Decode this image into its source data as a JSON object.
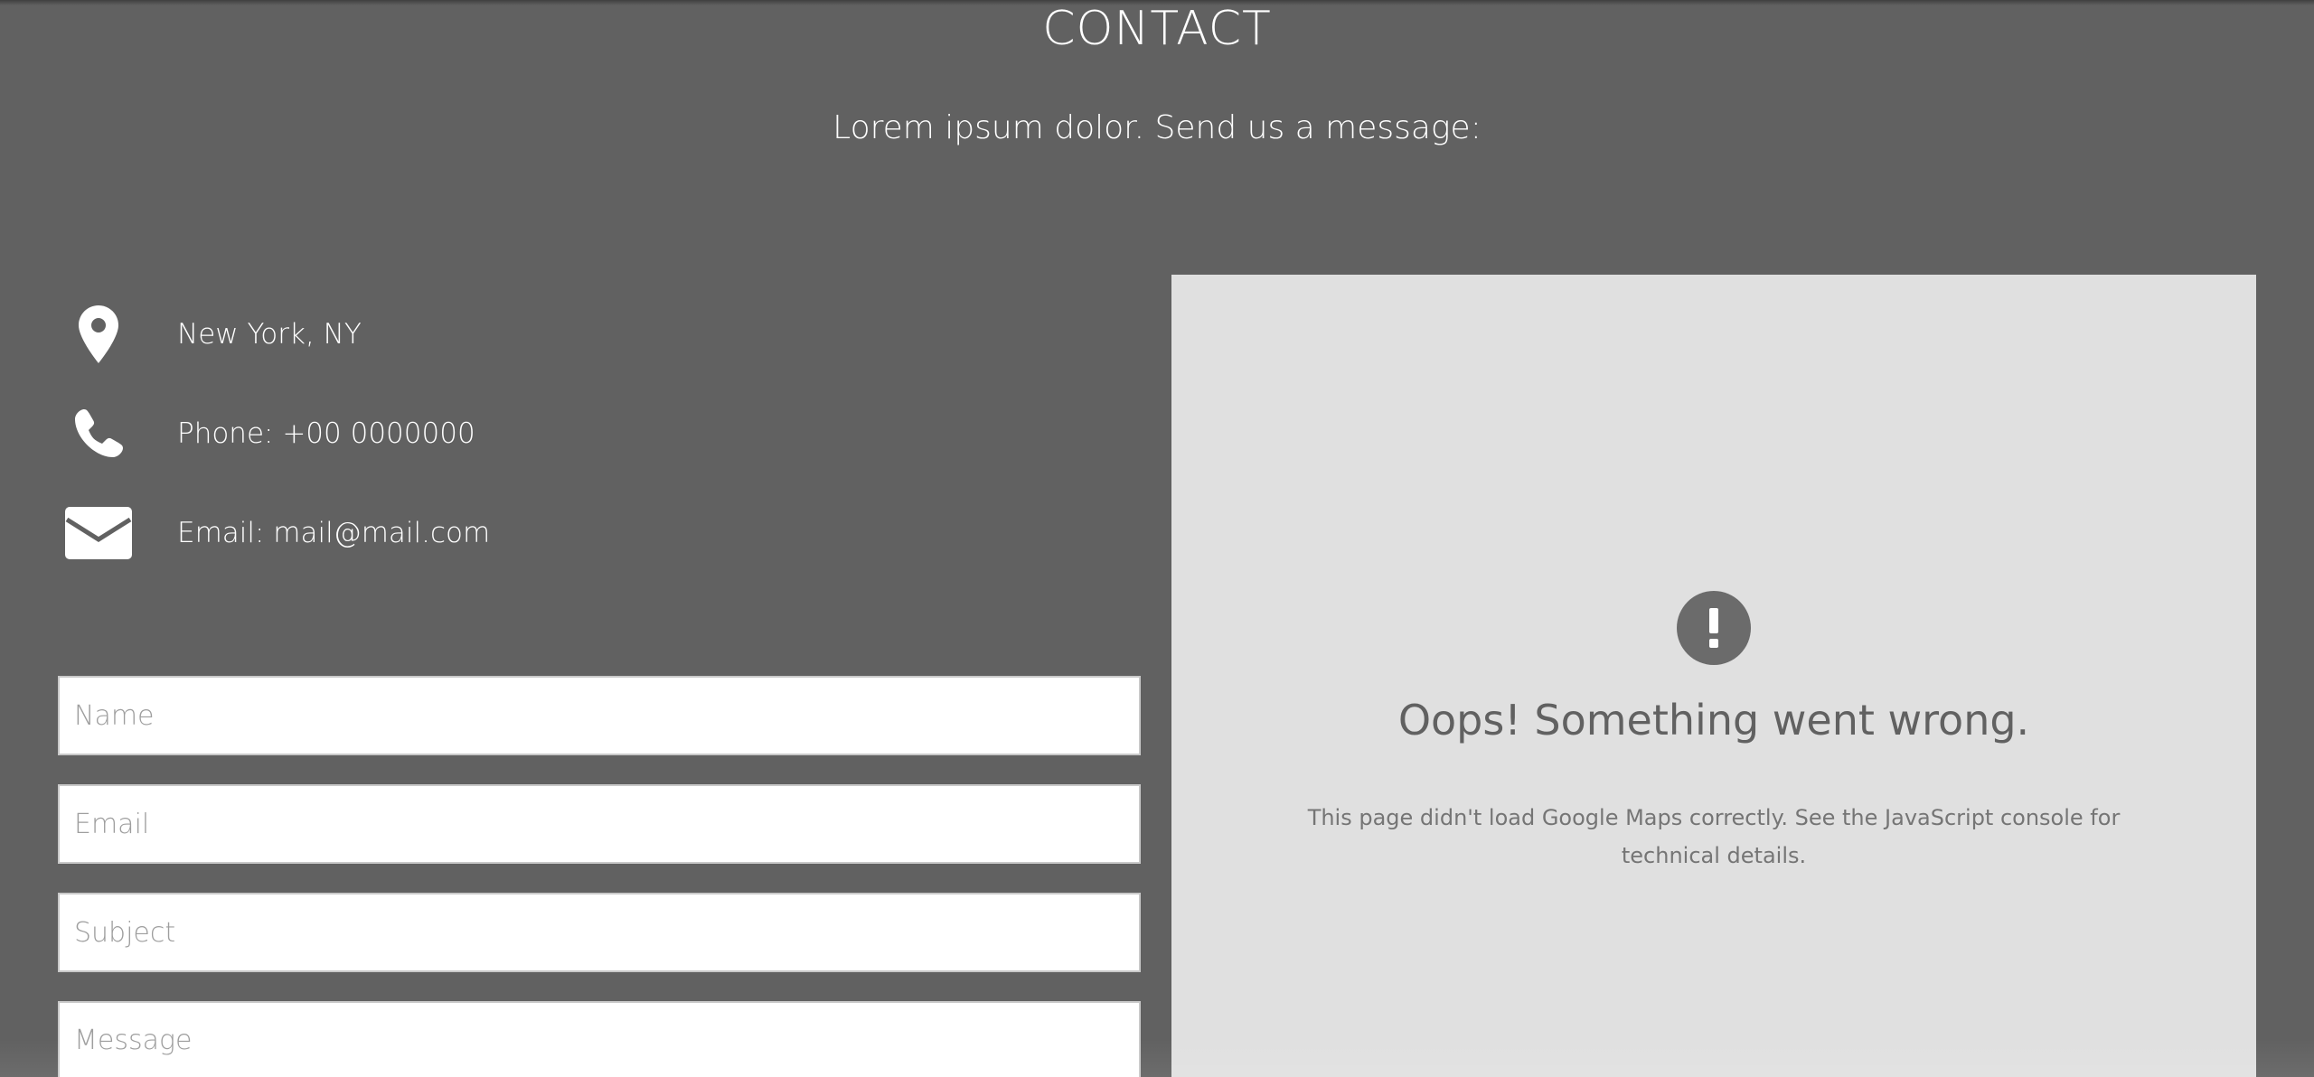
{
  "section": {
    "title": "CONTACT",
    "subtitle": "Lorem ipsum dolor. Send us a message:"
  },
  "contact_info": {
    "location": {
      "icon": "map-marker-icon",
      "text": "New York, NY"
    },
    "phone": {
      "icon": "phone-icon",
      "text": "Phone: +00 0000000"
    },
    "email": {
      "icon": "envelope-icon",
      "text": "Email: mail@mail.com"
    }
  },
  "form": {
    "name_placeholder": "Name",
    "email_placeholder": "Email",
    "subject_placeholder": "Subject",
    "message_placeholder": "Message"
  },
  "map": {
    "error_icon": "exclamation-circle-icon",
    "error_title": "Oops! Something went wrong.",
    "error_text": "This page didn't load Google Maps correctly. See the JavaScript console for technical details."
  },
  "colors": {
    "background": "#616161",
    "map_panel": "#e0e0e0",
    "text_light": "#ffffff"
  }
}
